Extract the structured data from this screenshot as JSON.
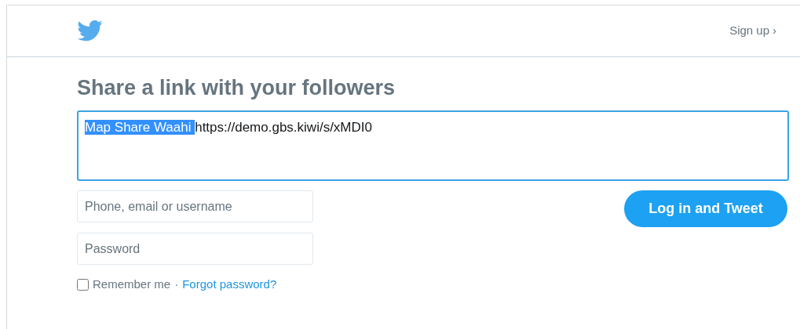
{
  "header": {
    "sign_up": "Sign up",
    "sign_up_arrow": "›"
  },
  "title": "Share a link with your followers",
  "tweet_box": {
    "segments": [
      {
        "text": "Map Share Waahi",
        "selected": true
      },
      {
        "text": "https://demo.gbs.kiwi/s/xMDI0",
        "selected": false
      }
    ]
  },
  "username_field": {
    "placeholder": "Phone, email or username"
  },
  "password_field": {
    "placeholder": "Password"
  },
  "remember_me": {
    "label": "Remember me",
    "checked": false
  },
  "separator": "·",
  "forgot_password": "Forgot password?",
  "submit_button": "Log in and Tweet"
}
